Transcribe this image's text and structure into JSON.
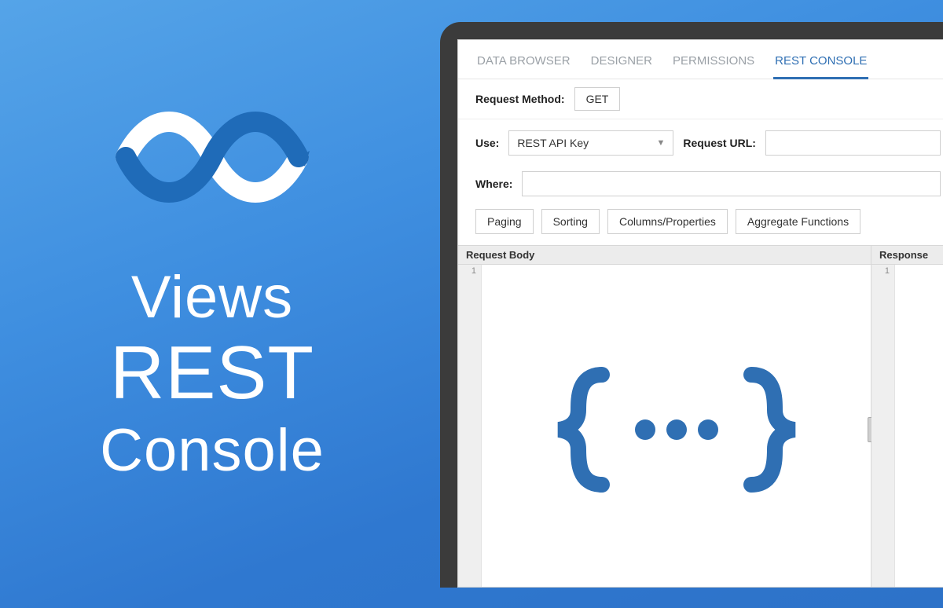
{
  "hero": {
    "line1": "Views",
    "line2": "REST",
    "line3": "Console"
  },
  "tabs": [
    {
      "label": "DATA BROWSER",
      "active": false
    },
    {
      "label": "DESIGNER",
      "active": false
    },
    {
      "label": "PERMISSIONS",
      "active": false
    },
    {
      "label": "REST CONSOLE",
      "active": true
    }
  ],
  "form": {
    "requestMethodLabel": "Request Method:",
    "requestMethodValue": "GET",
    "useLabel": "Use:",
    "useValue": "REST API Key",
    "requestUrlLabel": "Request URL:",
    "requestUrlValue": "",
    "whereLabel": "Where:",
    "whereValue": ""
  },
  "optionTabs": [
    "Paging",
    "Sorting",
    "Columns/Properties",
    "Aggregate Functions"
  ],
  "panels": {
    "requestBodyTitle": "Request Body",
    "responseTitle": "Response",
    "lineNumber": "1"
  },
  "colors": {
    "accent": "#2f6fb3"
  }
}
